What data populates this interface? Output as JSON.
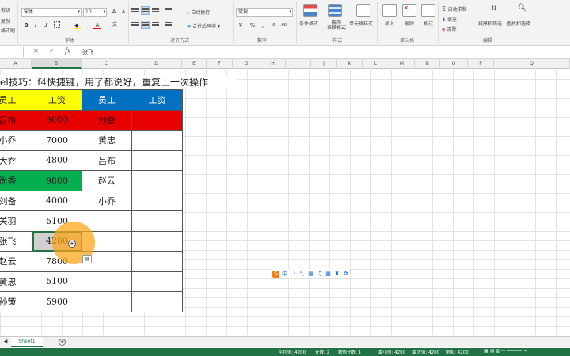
{
  "ribbon": {
    "clipboard_left": [
      "剪切",
      "复制",
      "格式刷"
    ],
    "font_name": "宋体",
    "font_size": "10",
    "groups": {
      "font": "字体",
      "alignment": "对齐方式",
      "number": "数字",
      "styles": "样式",
      "cells": "单元格",
      "editing": "编辑"
    },
    "wrap_text": "自动换行",
    "merge_center": "合并后居中",
    "number_format": "常规",
    "conditional_format": "条件格式",
    "format_as_table": "套用\n表格格式",
    "cell_styles": "单元格样式",
    "insert": "插入",
    "delete": "删除",
    "format": "格式",
    "autosum": "自动求和",
    "fill": "填充",
    "clear": "清除",
    "sort_filter": "排序和筛选",
    "find_select": "查找和选择",
    "bold": "B",
    "italic": "I",
    "underline": "U",
    "grow_font": "A",
    "shrink_font": "A",
    "percent": "%",
    "comma": ","
  },
  "formula_bar": {
    "fx": "fx",
    "content": "张飞"
  },
  "columns": [
    "A",
    "B",
    "C",
    "D",
    "E",
    "F",
    "G",
    "H",
    "I",
    "J",
    "K",
    "L",
    "M",
    "N",
    "O",
    "P",
    "Q"
  ],
  "title_text": "el技巧：f4快捷键，用了都说好，重复上一次操作",
  "table": {
    "headers": [
      "员工",
      "工资",
      "员工",
      "工资"
    ],
    "left_rows": [
      {
        "name": "吕布",
        "salary": "9000"
      },
      {
        "name": "小乔",
        "salary": "7000"
      },
      {
        "name": "大乔",
        "salary": "4800"
      },
      {
        "name": "尚香",
        "salary": "9800"
      },
      {
        "name": "刘备",
        "salary": "4000"
      },
      {
        "name": "关羽",
        "salary": "5100"
      },
      {
        "name": "张飞",
        "salary": "4200"
      },
      {
        "name": "赵云",
        "salary": "7800"
      },
      {
        "name": "黄忠",
        "salary": "5100"
      },
      {
        "name": "孙策",
        "salary": "5900"
      }
    ],
    "right_names": [
      "刘备",
      "黄忠",
      "吕布",
      "赵云",
      "小乔",
      "",
      "",
      "",
      "",
      ""
    ]
  },
  "colors": {
    "yellow": "#ffff00",
    "blue": "#0070c0",
    "red": "#e60000",
    "green": "#00b050",
    "excel_green": "#217346"
  },
  "sheet_tab": "Sheet1",
  "add_sheet": "+",
  "ime_label": "中",
  "status": {
    "average": "平均值: 4200",
    "count": "计数: 2",
    "numeric_count": "数值计数: 1",
    "min": "最小值: 4200",
    "max": "最大值: 4200",
    "sum": "求和: 4200"
  }
}
